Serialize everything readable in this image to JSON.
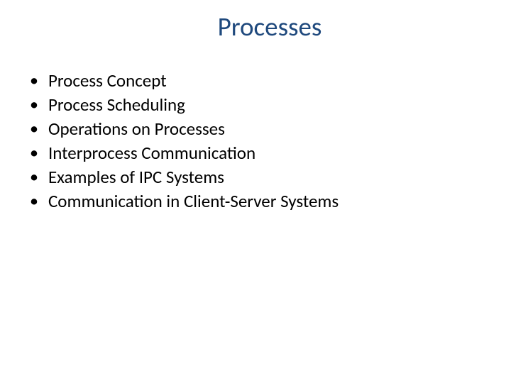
{
  "slide": {
    "title": "Processes",
    "bullets": [
      "Process Concept",
      "Process Scheduling",
      "Operations on Processes",
      "Interprocess Communication",
      "Examples of IPC Systems",
      "Communication in Client-Server Systems"
    ]
  }
}
